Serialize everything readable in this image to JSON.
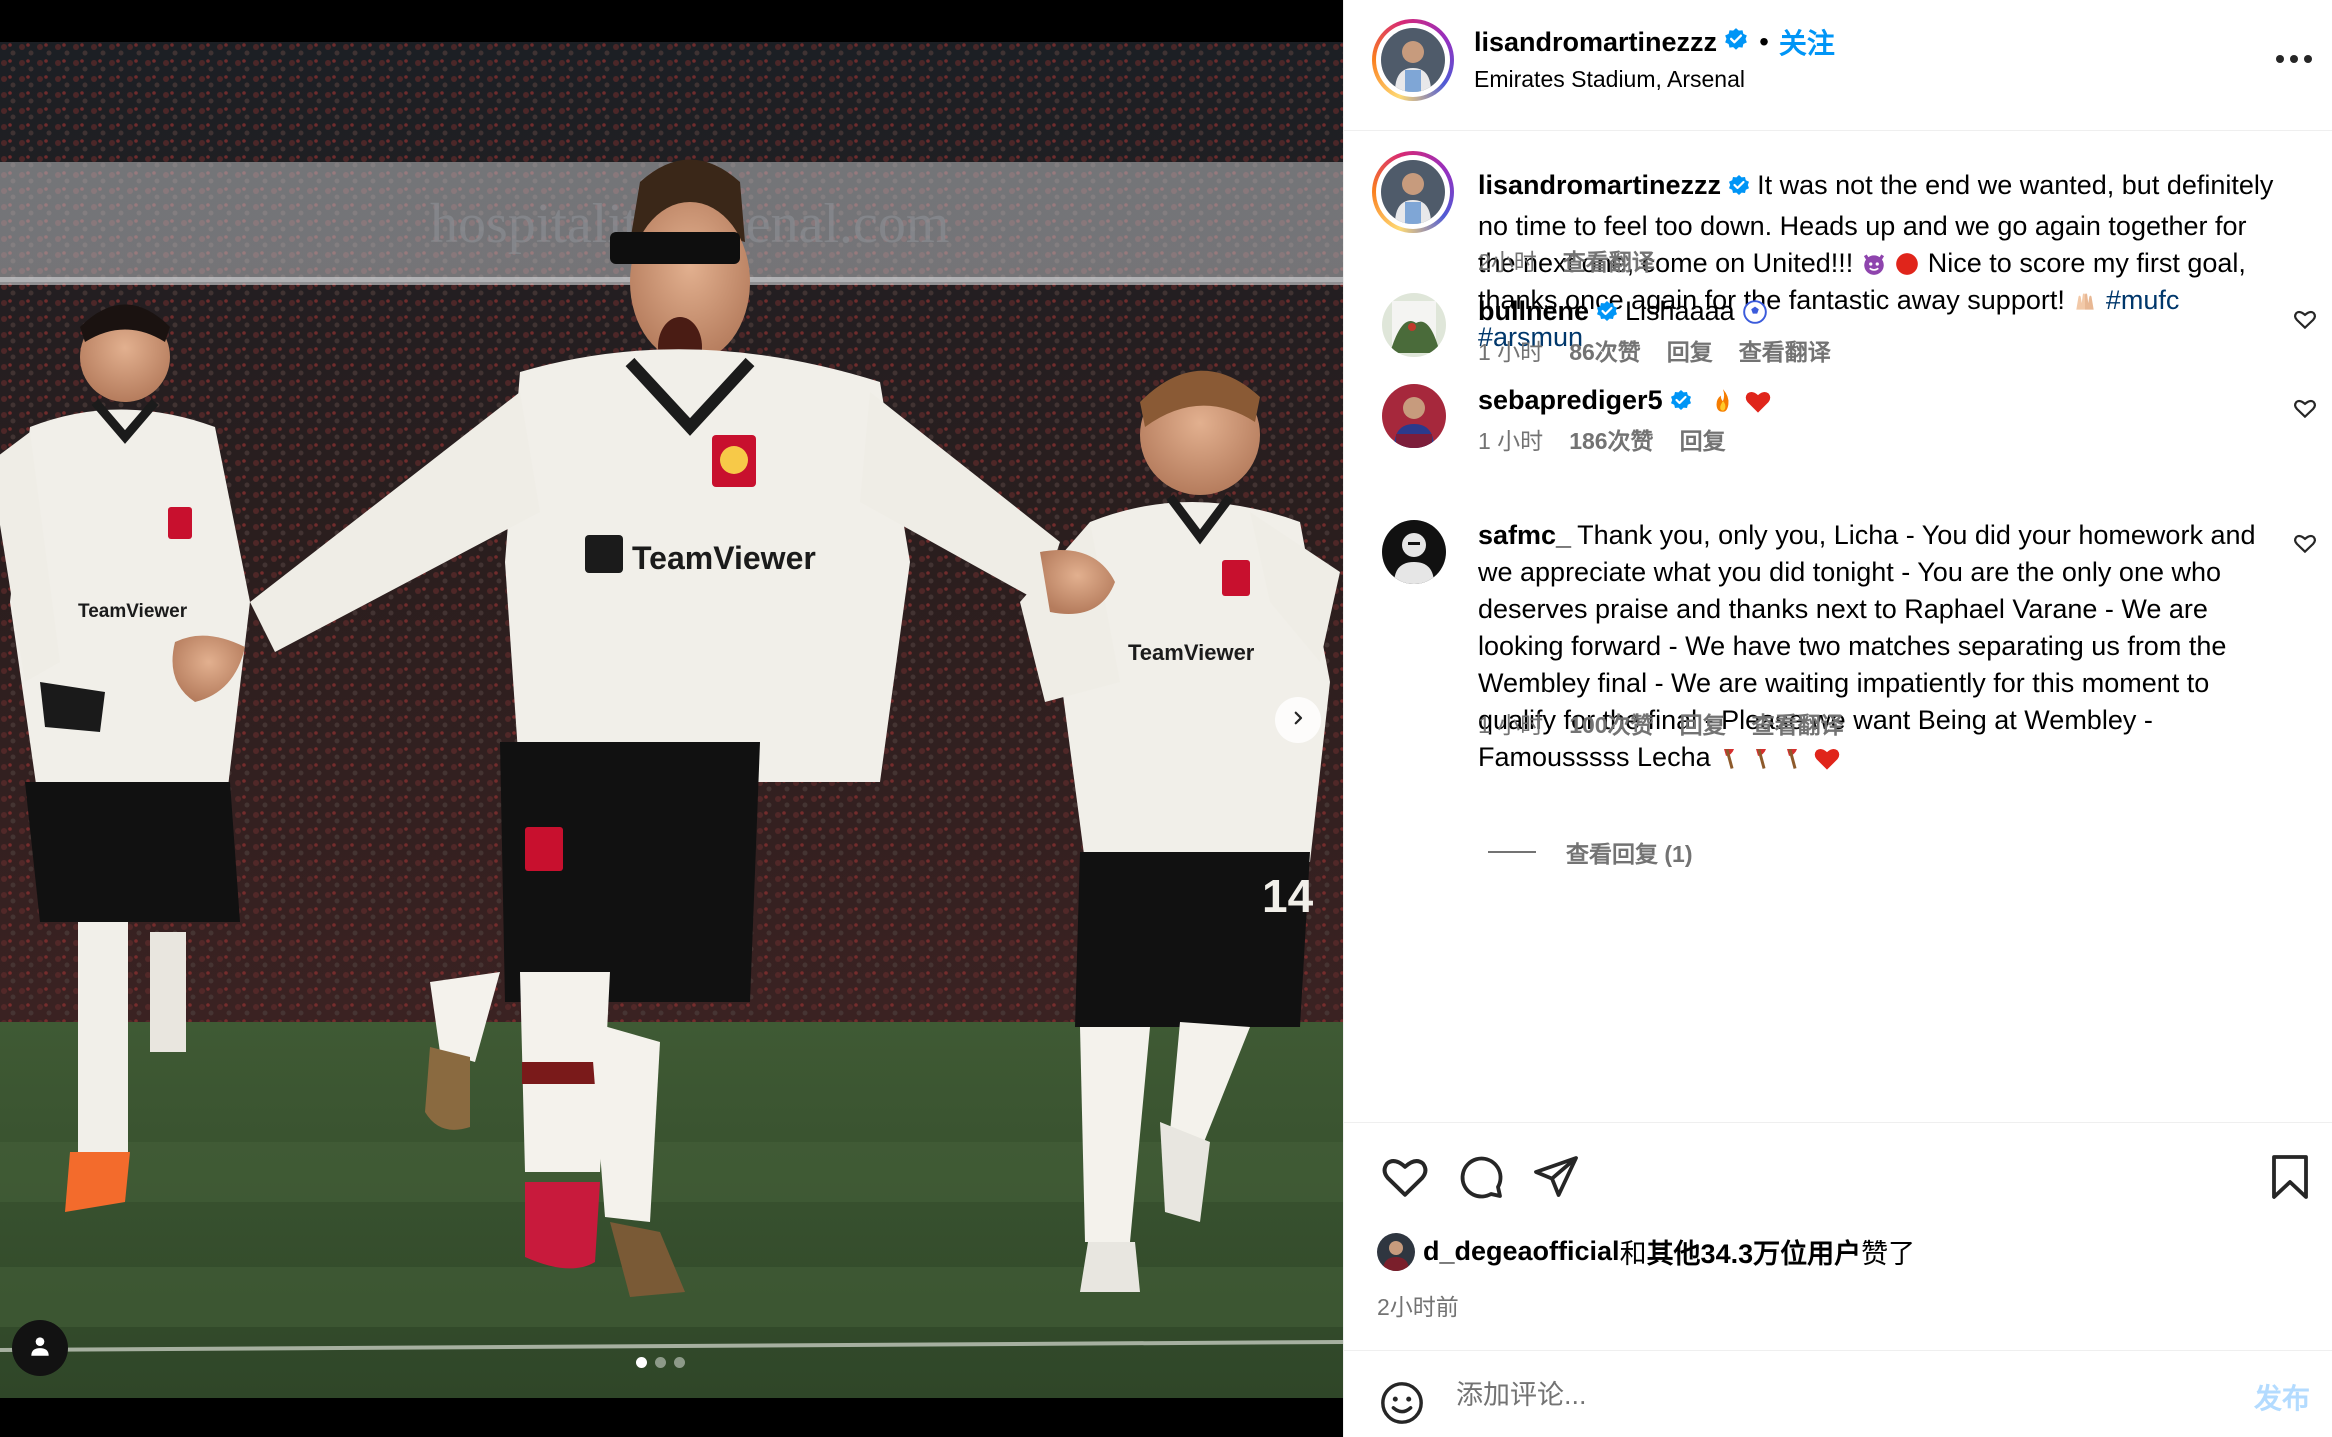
{
  "post": {
    "username": "lisandromartinezzz",
    "verified": true,
    "separator": "•",
    "follow_label": "关注",
    "location": "Emirates Stadium, Arsenal",
    "more_icon": "more-horizontal-icon"
  },
  "media": {
    "carousel_total": 3,
    "carousel_active": 1,
    "next_icon": "chevron-right-icon",
    "tag_icon": "user-tag-icon",
    "watermark": "hospitality arsenal.com",
    "shirt_sponsor": "TeamViewer"
  },
  "caption": {
    "username": "lisandromartinezzz",
    "text_part1": "It was not the end we wanted, but definitely no time to feel too down. Heads up and we go again together for the next one, come on United!!!",
    "text_part2": "Nice to score my first goal, thanks once again for the fantastic away support!",
    "hashtags": [
      "#mufc",
      "#arsmun"
    ],
    "time": "2小时",
    "translate_label": "查看翻译"
  },
  "comments": [
    {
      "username": "bullnene",
      "verified": true,
      "text": "Lishaaaa",
      "time": "1 小时",
      "likes": "86次赞",
      "reply_label": "回复",
      "translate_label": "查看翻译"
    },
    {
      "username": "sebaprediger5",
      "verified": true,
      "text": "",
      "time": "1 小时",
      "likes": "186次赞",
      "reply_label": "回复",
      "view_replies": "查看回复 (1)"
    },
    {
      "username": "safmc_",
      "verified": false,
      "text": "Thank you, only you, Licha - You did your homework and we appreciate what you did tonight - You are the only one who deserves praise and thanks next to Raphael Varane - We are looking forward - We have two matches separating us from the Wembley final - We are waiting impatiently for this moment to qualify for the final - Please we want Being at Wembley - Famousssss Lecha",
      "time": "1 小时",
      "likes": "100次赞",
      "reply_label": "回复",
      "translate_label": "查看翻译"
    }
  ],
  "actions": {
    "icons": [
      "heart-icon",
      "comment-icon",
      "share-icon",
      "bookmark-icon"
    ],
    "liked_by_user": "d_degeaofficial",
    "liked_by_mid": "和",
    "liked_by_others": "其他34.3万位用户",
    "liked_by_suffix": "赞了",
    "time_ago": "2小时前"
  },
  "add_comment": {
    "placeholder": "添加评论...",
    "post_label": "发布"
  },
  "colors": {
    "link_blue": "#0095f6",
    "hashtag": "#00376b",
    "muted": "#737373",
    "divider": "#efefef",
    "like_red": "#ff3040"
  }
}
